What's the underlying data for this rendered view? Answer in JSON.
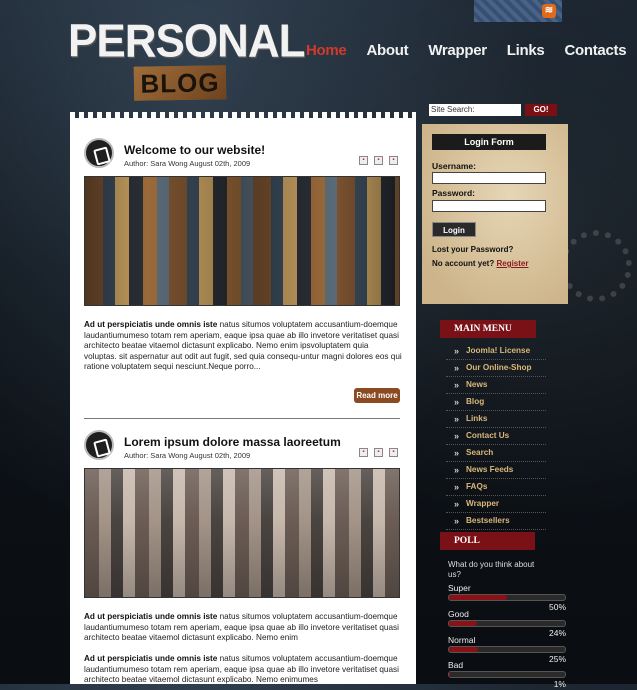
{
  "header": {
    "logo_top": "PERSONAL",
    "logo_bottom": "BLOG",
    "nav": [
      "Home",
      "About",
      "Wrapper",
      "Links",
      "Contacts"
    ],
    "nav_active": "Home"
  },
  "posts": [
    {
      "title": "Welcome to our website!",
      "meta": "Author: Sara Wong    August 02th, 2009",
      "text_bold": "Ad ut perspiciatis unde omnis iste",
      "text": " natus situmos voluptatem accusantium-doemque laudantiumumeso totam rem aperiam, eaque ipsa quae ab illo invetore veritatiset quasi architecto beatae vitaemol dictasunt explicabo. Nemo enim ipsvoluptatem quia voluptas. sit aspernatur aut odit aut fugit, sed quia consequ-untur magni dolores eos qui ratione voluptatem sequi nesciunt.Neque porro...",
      "read_more": "Read more"
    },
    {
      "title": "Lorem ipsum dolore massa laoreetum",
      "meta": "Author: Sara Wong    August 02th, 2009",
      "text_bold": "Ad ut perspiciatis unde omnis iste",
      "text": " natus situmos voluptatem accusantium-doemque laudantiumumeso totam rem aperiam, eaque ipsa quae ab illo invetore veritatiset quasi architecto beatae vitaemol dictasunt explicabo. Nemo enim",
      "text2_bold": "Ad ut perspiciatis unde omnis iste",
      "text2": " natus situmos voluptatem accusantium-doemque laudantiumumeso totam rem aperiam, eaque ipsa quae ab illo invetore veritatiset quasi architecto beatae vitaemol dictasunt explicabo. Nemo enimumes"
    }
  ],
  "search": {
    "label": "Site Search:",
    "button": "GO!"
  },
  "login": {
    "title": "Login Form",
    "username_label": "Username:",
    "password_label": "Password:",
    "button": "Login",
    "lost_password": "Lost your Password?",
    "no_account": "No account yet?",
    "register": "Register"
  },
  "main_menu": {
    "title": "MAIN MENU",
    "items": [
      "Joomla! License",
      "Our Online-Shop",
      "News",
      "Blog",
      "Links",
      "Contact Us",
      "Search",
      "News Feeds",
      "FAQs",
      "Wrapper",
      "Bestsellers"
    ]
  },
  "poll": {
    "title": "POLL",
    "question": "What do you think about us?",
    "options": [
      {
        "label": "Super",
        "percent": 50,
        "pct_text": "50%"
      },
      {
        "label": "Good",
        "percent": 24,
        "pct_text": "24%"
      },
      {
        "label": "Normal",
        "percent": 25,
        "pct_text": "25%"
      },
      {
        "label": "Bad",
        "percent": 1,
        "pct_text": "1%"
      }
    ]
  },
  "colors": {
    "accent_red": "#7a1116",
    "nav_active": "#d23a2a",
    "menu_text": "#d9b77a"
  }
}
